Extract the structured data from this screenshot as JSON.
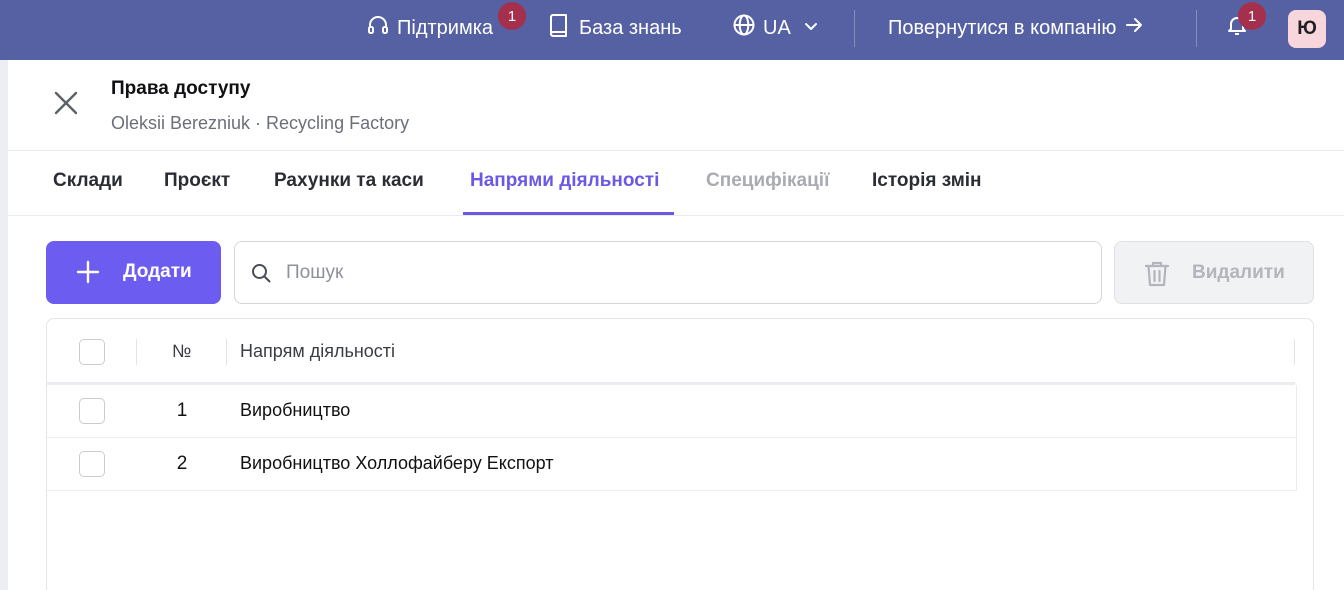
{
  "topbar": {
    "support_label": "Підтримка",
    "support_badge": "1",
    "knowledge_label": "База знань",
    "language_label": "UA",
    "return_label": "Повернутися в компанію",
    "notifications_badge": "1",
    "avatar_initial": "Ю",
    "bg_color": "#5561a3",
    "badge_color": "#a5304e"
  },
  "panel": {
    "title": "Права доступу",
    "subtitle": "Oleksii Berezniuk · Recycling Factory"
  },
  "tabs": [
    {
      "label": "Склади",
      "state": "normal"
    },
    {
      "label": "Проєкт",
      "state": "normal"
    },
    {
      "label": "Рахунки та каси",
      "state": "normal"
    },
    {
      "label": "Напрями діяльності",
      "state": "active"
    },
    {
      "label": "Специфікації",
      "state": "disabled"
    },
    {
      "label": "Історія змін",
      "state": "normal"
    }
  ],
  "toolbar": {
    "add_label": "Додати",
    "search_placeholder": "Пошук",
    "search_value": "",
    "delete_label": "Видалити",
    "accent_color": "#6c5cf0"
  },
  "table": {
    "columns": {
      "number": "№",
      "direction": "Напрям діяльності"
    },
    "rows": [
      {
        "number": "1",
        "direction": "Виробництво"
      },
      {
        "number": "2",
        "direction": "Виробництво Холлофайберу Експорт"
      }
    ]
  },
  "icons": [
    "headset-icon",
    "book-icon",
    "globe-icon",
    "chevron-down-icon",
    "arrow-right-icon",
    "bell-icon",
    "close-icon",
    "plus-icon",
    "search-icon",
    "trash-icon"
  ]
}
